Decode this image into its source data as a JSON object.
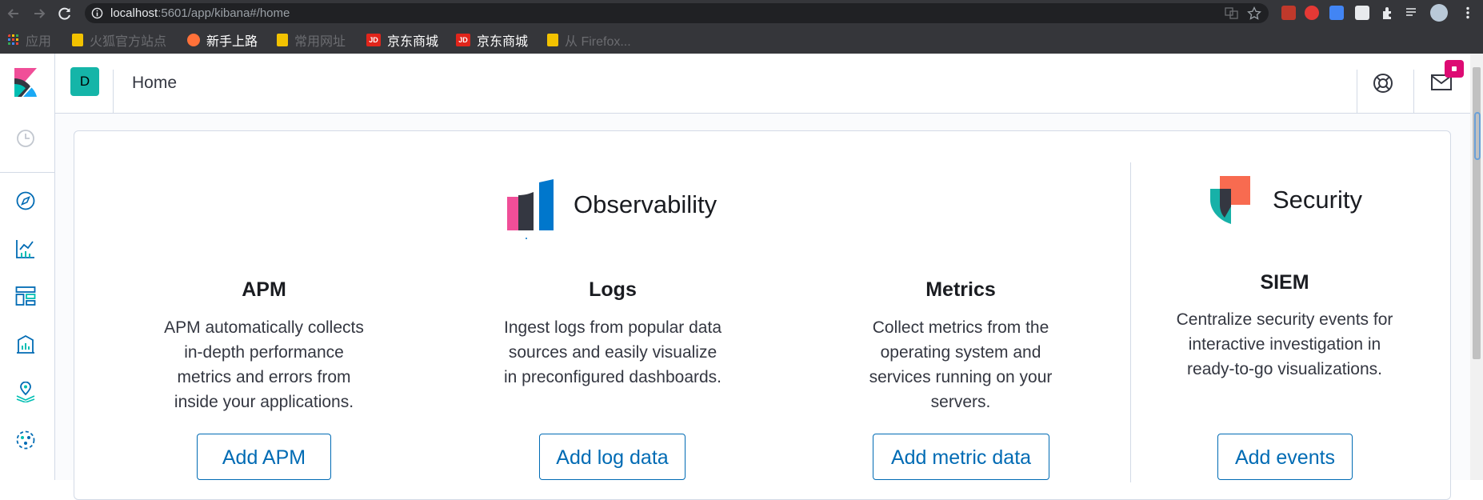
{
  "browser": {
    "url_host": "localhost",
    "url_path": ":5601/app/kibana#/home",
    "bookmarks": [
      {
        "label": "应用",
        "dim": true,
        "color": "#4285f4"
      },
      {
        "label": "火狐官方站点",
        "dim": true,
        "color": "#f2c200"
      },
      {
        "label": "新手上路",
        "dim": false,
        "color": "#ff7139"
      },
      {
        "label": "常用网址",
        "dim": true,
        "color": "#f2c200"
      },
      {
        "label": "京东商城",
        "dim": false,
        "color": "#e1251b"
      },
      {
        "label": "京东商城",
        "dim": false,
        "color": "#e1251b"
      },
      {
        "label": "从 Firefox...",
        "dim": true,
        "color": "#f2c200"
      }
    ],
    "bookmark_badges": {
      "jd": "JD"
    }
  },
  "header": {
    "space_initial": "D",
    "page_title": "Home"
  },
  "sections": {
    "observability": {
      "title": "Observability"
    },
    "security": {
      "title": "Security"
    }
  },
  "features": [
    {
      "title": "APM",
      "desc_lines": [
        "APM automatically collects",
        "in-depth performance",
        "metrics and errors from",
        "inside your applications."
      ],
      "button": "Add APM"
    },
    {
      "title": "Logs",
      "desc_lines": [
        "Ingest logs from popular data",
        "sources and easily visualize",
        "in preconfigured dashboards."
      ],
      "button": "Add log data"
    },
    {
      "title": "Metrics",
      "desc_lines": [
        "Collect metrics from the",
        "operating system and",
        "services running on your",
        "servers."
      ],
      "button": "Add metric data"
    },
    {
      "title": "SIEM",
      "desc_lines": [
        "Centralize security events for",
        "interactive investigation in",
        "ready-to-go visualizations."
      ],
      "button": "Add events"
    }
  ],
  "colors": {
    "accent": "#006bb4",
    "space_avatar": "#15b5a8",
    "badge": "#dd0a73",
    "observability_pink": "#f04e98",
    "observability_dark": "#343741",
    "observability_blue": "#0077cc",
    "security_orange": "#f86b50",
    "security_teal": "#17b1a8",
    "security_dark": "#343741"
  }
}
